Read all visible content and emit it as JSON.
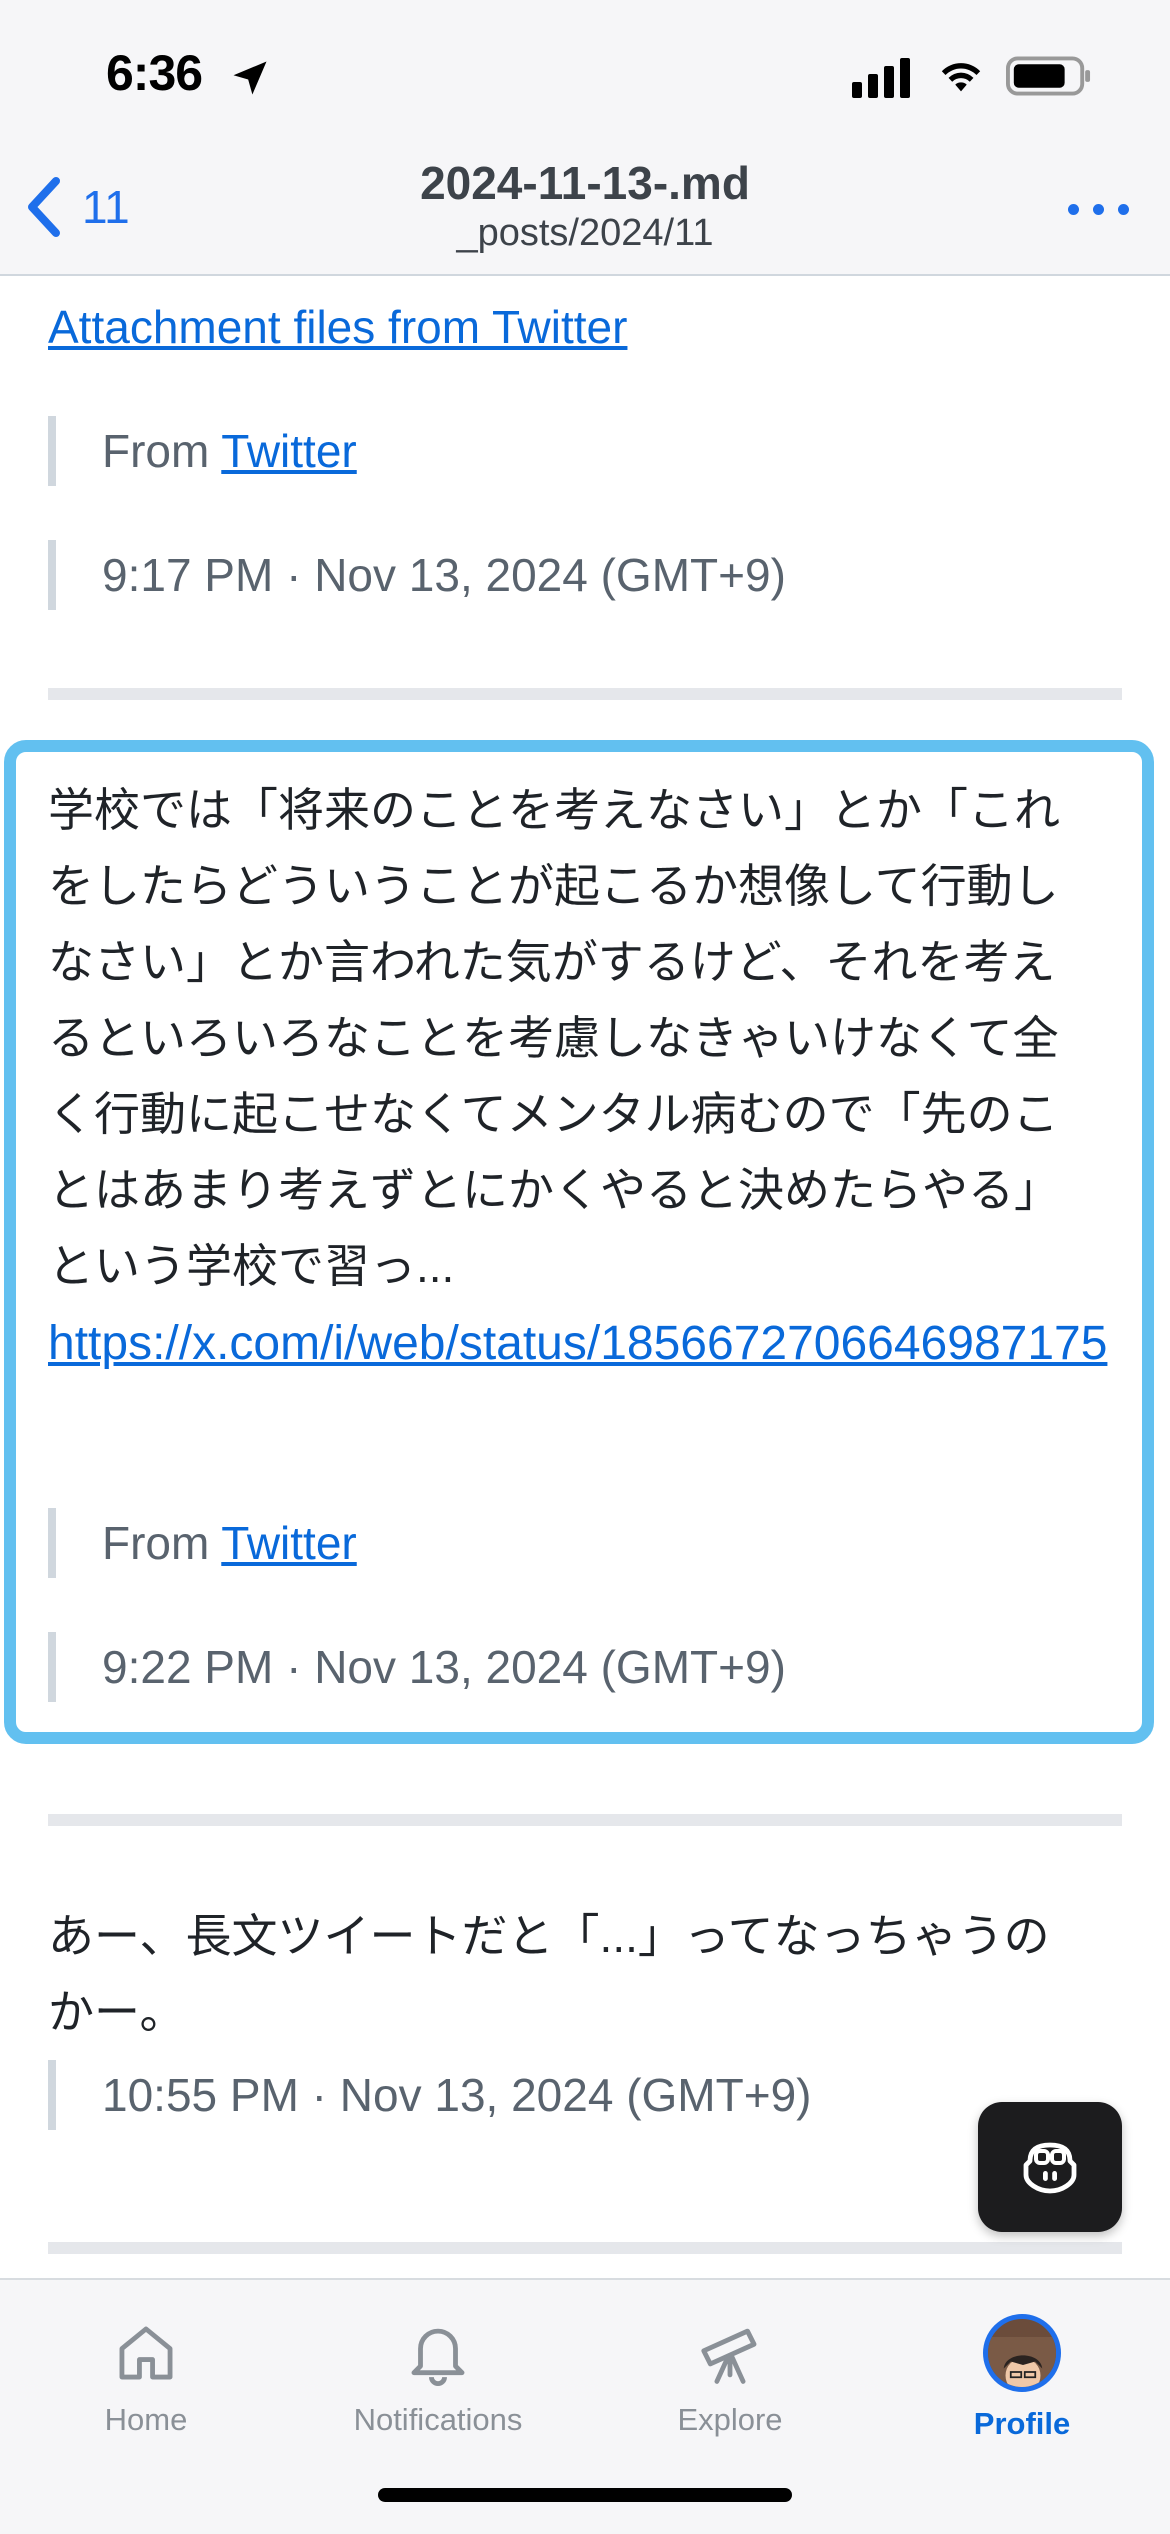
{
  "status_bar": {
    "time": "6:36"
  },
  "nav": {
    "back_label": "11",
    "title": "2024-11-13-.md",
    "subtitle": "_posts/2024/11"
  },
  "posts": [
    {
      "link": "Attachment files from Twitter",
      "from_prefix": "From ",
      "from_link": "Twitter",
      "timestamp": "9:17 PM · Nov 13, 2024 (GMT+9)"
    },
    {
      "lines": [
        "学校では「将来のことを考えなさい」とか「これ",
        "をしたらどういうことが起こるか想像して行動し",
        "なさい」とか言われた気がするけど、それを考え",
        "るといろいろなことを考慮しなきゃいけなくて全",
        "く行動に起こせなくてメンタル病むので「先のこ",
        "とはあまり考えずとにかくやると決めたらやる」",
        "という学校で習っ..."
      ],
      "url": "https://x.com/i/web/status/1856672706646987175",
      "from_prefix": "From ",
      "from_link": "Twitter",
      "timestamp": "9:22 PM · Nov 13, 2024 (GMT+9)"
    },
    {
      "lines": [
        "あー、長文ツイートだと「...」ってなっちゃうの",
        "かー。"
      ],
      "timestamp": "10:55 PM · Nov 13, 2024 (GMT+9)"
    }
  ],
  "tabs": [
    {
      "label": "Home",
      "icon": "home-icon"
    },
    {
      "label": "Notifications",
      "icon": "bell-icon"
    },
    {
      "label": "Explore",
      "icon": "telescope-icon"
    },
    {
      "label": "Profile",
      "icon": "avatar"
    }
  ],
  "active_tab": "Profile",
  "colors": {
    "accent": "#0969da",
    "selection": "#62c0f0"
  }
}
